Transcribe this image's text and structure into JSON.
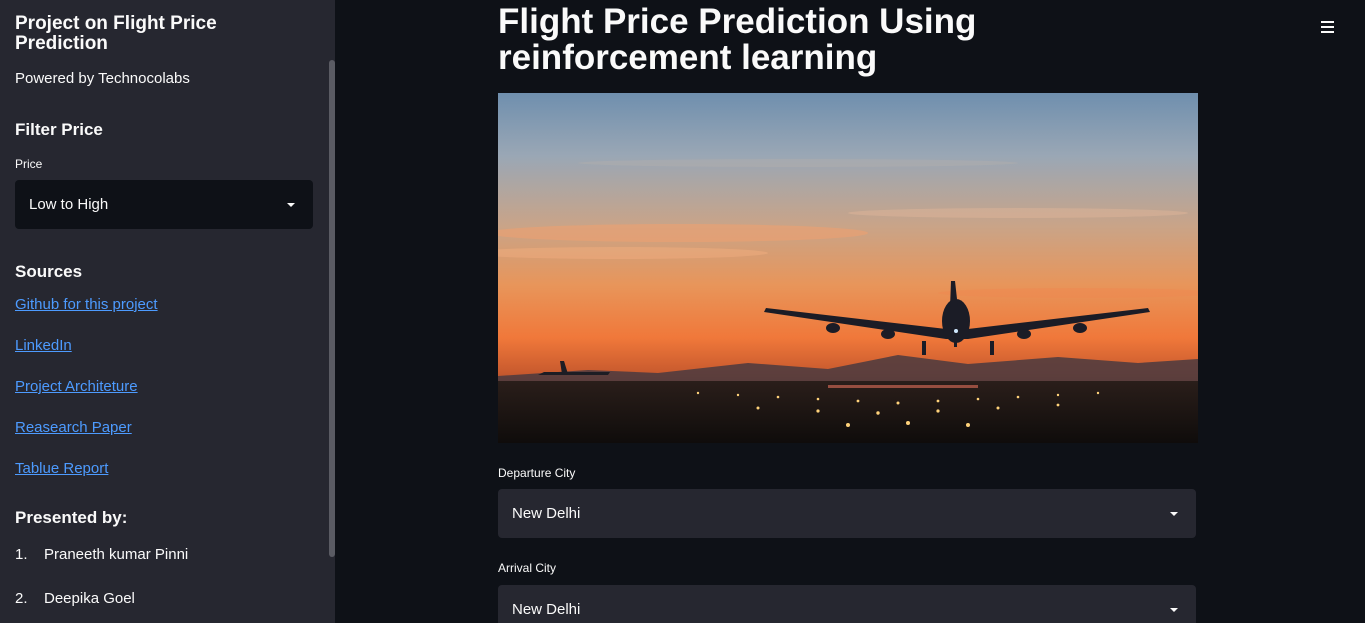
{
  "sidebar": {
    "title_line1": "Project on Flight Price",
    "title_line2": "Prediction",
    "powered": "Powered by Technocolabs",
    "filter_heading": "Filter Price",
    "price_label": "Price",
    "price_value": "Low to High",
    "sources_heading": "Sources",
    "links": [
      {
        "label": "Github for this project"
      },
      {
        "label": "LinkedIn"
      },
      {
        "label": "Project Architeture"
      },
      {
        "label": "Reasearch Paper"
      },
      {
        "label": "Tablue Report"
      }
    ],
    "presented_heading": "Presented by:",
    "people": [
      {
        "num": "1.",
        "name": "Praneeth kumar Pinni"
      },
      {
        "num": "2.",
        "name": "Deepika Goel"
      }
    ]
  },
  "main": {
    "title_line1": "Flight Price Prediction Using",
    "title_line2": "reinforcement learning",
    "departure_label": "Departure City",
    "departure_value": "New Delhi",
    "arrival_label": "Arrival City",
    "arrival_value": "New Delhi"
  },
  "icons": {
    "menu": "hamburger-menu-icon",
    "select_caret": "caret-down-icon"
  },
  "colors": {
    "background": "#0e1117",
    "sidebar": "#262730",
    "link": "#4d9bff",
    "text": "#fafafa"
  }
}
